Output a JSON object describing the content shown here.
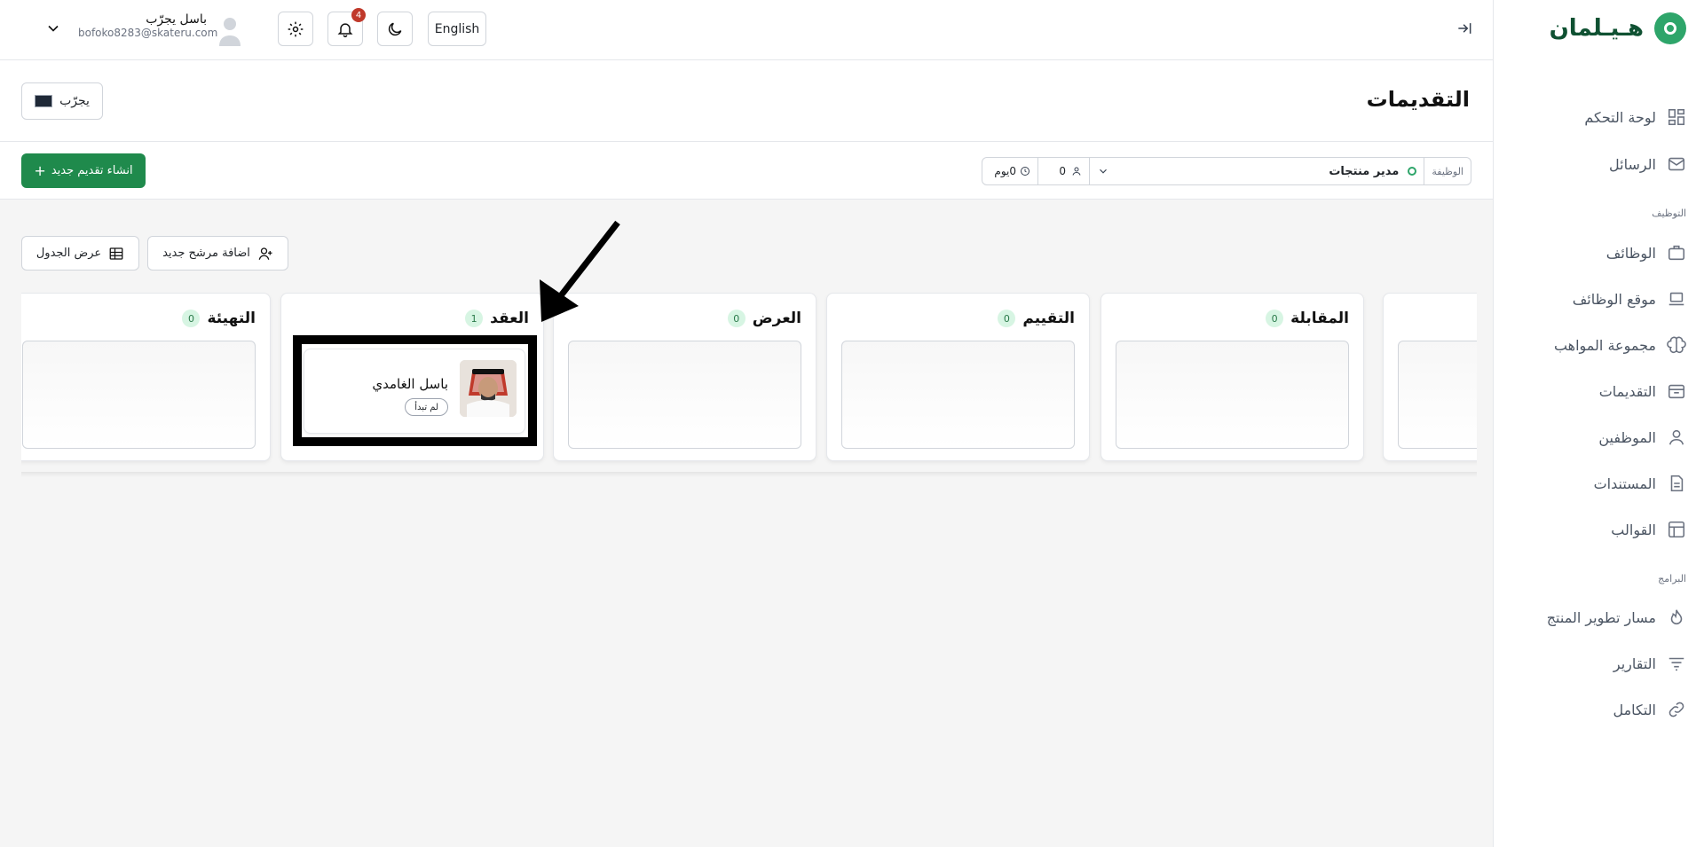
{
  "sidebar": {
    "logo_text": "هـيـلمان",
    "items": [
      {
        "label": "لوحة التحكم",
        "icon": "dashboard-icon"
      },
      {
        "label": "الرسائل",
        "icon": "mail-icon"
      },
      {
        "label": "الوظائف",
        "icon": "briefcase-icon"
      },
      {
        "label": "موقع الوظائف",
        "icon": "laptop-icon"
      },
      {
        "label": "مجموعة المواهب",
        "icon": "brain-icon"
      },
      {
        "label": "التقديمات",
        "icon": "inbox-icon"
      },
      {
        "label": "الموظفين",
        "icon": "user-icon"
      },
      {
        "label": "المستندات",
        "icon": "document-icon"
      },
      {
        "label": "القوالب",
        "icon": "layout-icon"
      },
      {
        "label": "مسار تطوير المنتج",
        "icon": "flame-icon"
      },
      {
        "label": "التقارير",
        "icon": "filter-icon"
      },
      {
        "label": "التكامل",
        "icon": "link-icon"
      }
    ],
    "sections": {
      "hiring": "التوظيف",
      "programs": "البرامج"
    }
  },
  "topbar": {
    "language_label": "English",
    "notification_count": "4",
    "user_name": "باسل يجرّب",
    "user_email": "bofoko8283@skateru.com"
  },
  "header": {
    "title": "التقديمات",
    "tester_label": "يجرّب"
  },
  "toolbar": {
    "create_label": "انشاء تقديم جديد",
    "job_label": "الوظيفة",
    "job_value": "مدير منتجات",
    "applicants_count": "0",
    "days_value": "0يوم"
  },
  "board": {
    "add_candidate_label": "اضافة مرشح جديد",
    "table_view_label": "عرض الجدول",
    "columns": [
      {
        "title": "المقابلة",
        "count": "0"
      },
      {
        "title": "التقييم",
        "count": "0"
      },
      {
        "title": "العرض",
        "count": "0"
      },
      {
        "title": "العقد",
        "count": "1"
      },
      {
        "title": "التهيئة",
        "count": "0"
      }
    ],
    "candidate": {
      "name": "باسل الغامدي",
      "status": "لم تبدأ"
    }
  }
}
